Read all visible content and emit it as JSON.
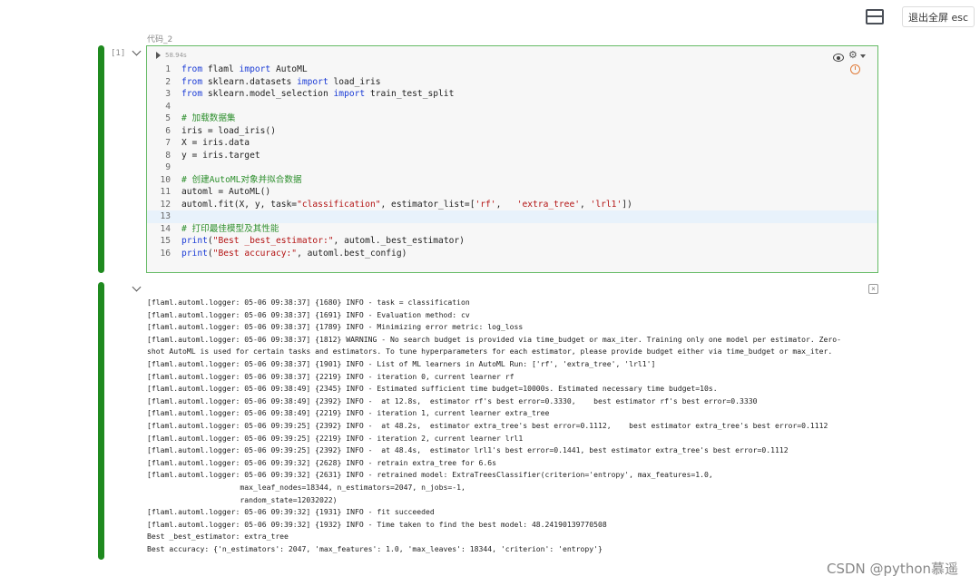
{
  "toolbar": {
    "fullscreen_exit_label": "退出全屏 esc",
    "layout_icon": "split-layout-icon"
  },
  "cell": {
    "title": "代码_2",
    "exec_count": "[1]",
    "run_time": "58.94s",
    "code_lines": [
      [
        {
          "t": "from",
          "c": "kw"
        },
        {
          "t": " flaml "
        },
        {
          "t": "import",
          "c": "kw"
        },
        {
          "t": " AutoML"
        }
      ],
      [
        {
          "t": "from",
          "c": "kw"
        },
        {
          "t": " sklearn.datasets "
        },
        {
          "t": "import",
          "c": "kw"
        },
        {
          "t": " load_iris"
        }
      ],
      [
        {
          "t": "from",
          "c": "kw"
        },
        {
          "t": " sklearn.model_selection "
        },
        {
          "t": "import",
          "c": "kw"
        },
        {
          "t": " train_test_split"
        }
      ],
      [],
      [
        {
          "t": "# 加载数据集",
          "c": "cm"
        }
      ],
      [
        {
          "t": "iris = load_iris()"
        }
      ],
      [
        {
          "t": "X = iris.data"
        }
      ],
      [
        {
          "t": "y = iris.target"
        }
      ],
      [],
      [
        {
          "t": "# 创建AutoML对象并拟合数据",
          "c": "cm"
        }
      ],
      [
        {
          "t": "automl = AutoML()"
        }
      ],
      [
        {
          "t": "automl.fit(X, y, task="
        },
        {
          "t": "\"classification\"",
          "c": "str"
        },
        {
          "t": ", estimator_list=["
        },
        {
          "t": "'rf'",
          "c": "str"
        },
        {
          "t": ",   "
        },
        {
          "t": "'extra_tree'",
          "c": "str"
        },
        {
          "t": ", "
        },
        {
          "t": "'lrl1'",
          "c": "str"
        },
        {
          "t": "])"
        }
      ],
      [],
      [
        {
          "t": "# 打印最佳模型及其性能",
          "c": "cm"
        }
      ],
      [
        {
          "t": "print",
          "c": "kw"
        },
        {
          "t": "("
        },
        {
          "t": "\"Best _best_estimator:\"",
          "c": "str"
        },
        {
          "t": ", automl._best_estimator)"
        }
      ],
      [
        {
          "t": "print",
          "c": "kw"
        },
        {
          "t": "("
        },
        {
          "t": "\"Best accuracy:\"",
          "c": "str"
        },
        {
          "t": ", automl.best_config)"
        }
      ]
    ],
    "active_line": 13
  },
  "output": {
    "lines": [
      "[flaml.automl.logger: 05-06 09:38:37] {1680} INFO - task = classification",
      "[flaml.automl.logger: 05-06 09:38:37] {1691} INFO - Evaluation method: cv",
      "[flaml.automl.logger: 05-06 09:38:37] {1789} INFO - Minimizing error metric: log_loss",
      "[flaml.automl.logger: 05-06 09:38:37] {1812} WARNING - No search budget is provided via time_budget or max_iter. Training only one model per estimator. Zero-",
      "shot AutoML is used for certain tasks and estimators. To tune hyperparameters for each estimator, please provide budget either via time_budget or max_iter.",
      "[flaml.automl.logger: 05-06 09:38:37] {1901} INFO - List of ML learners in AutoML Run: ['rf', 'extra_tree', 'lrl1']",
      "[flaml.automl.logger: 05-06 09:38:37] {2219} INFO - iteration 0, current learner rf",
      "[flaml.automl.logger: 05-06 09:38:49] {2345} INFO - Estimated sufficient time budget=10000s. Estimated necessary time budget=10s.",
      "[flaml.automl.logger: 05-06 09:38:49] {2392} INFO -  at 12.8s,  estimator rf's best error=0.3330,    best estimator rf's best error=0.3330",
      "[flaml.automl.logger: 05-06 09:38:49] {2219} INFO - iteration 1, current learner extra_tree",
      "[flaml.automl.logger: 05-06 09:39:25] {2392} INFO -  at 48.2s,  estimator extra_tree's best error=0.1112,    best estimator extra_tree's best error=0.1112",
      "[flaml.automl.logger: 05-06 09:39:25] {2219} INFO - iteration 2, current learner lrl1",
      "[flaml.automl.logger: 05-06 09:39:25] {2392} INFO -  at 48.4s,  estimator lrl1's best error=0.1441, best estimator extra_tree's best error=0.1112",
      "[flaml.automl.logger: 05-06 09:39:32] {2628} INFO - retrain extra_tree for 6.6s",
      "[flaml.automl.logger: 05-06 09:39:32] {2631} INFO - retrained model: ExtraTreesClassifier(criterion='entropy', max_features=1.0,",
      "                     max_leaf_nodes=18344, n_estimators=2047, n_jobs=-1,",
      "                     random_state=12032022)",
      "[flaml.automl.logger: 05-06 09:39:32] {1931} INFO - fit succeeded",
      "[flaml.automl.logger: 05-06 09:39:32] {1932} INFO - Time taken to find the best model: 48.24190139770508",
      "Best _best_estimator: extra_tree",
      "Best accuracy: {'n_estimators': 2047, 'max_features': 1.0, 'max_leaves': 18344, 'criterion': 'entropy'}"
    ]
  },
  "watermark": "CSDN @python慕遥",
  "colors": {
    "keyword": "#1a3bd6",
    "string": "#b31212",
    "comment": "#2d8f2d",
    "run_bar": "#1f8a1f"
  }
}
